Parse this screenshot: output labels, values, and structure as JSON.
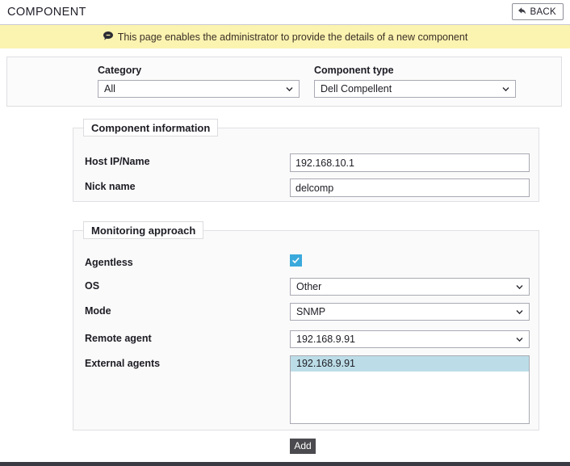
{
  "header": {
    "title": "COMPONENT",
    "back_label": "BACK",
    "back_icon": "back-arrow-icon"
  },
  "info_bar": {
    "icon": "speech-bubble-icon",
    "message": "This page enables the administrator to provide the details of a new component",
    "background_color": "#fbf3b0"
  },
  "selection_panel": {
    "category": {
      "label": "Category",
      "value": "All"
    },
    "component_type": {
      "label": "Component type",
      "value": "Dell Compellent"
    }
  },
  "component_information": {
    "legend": "Component information",
    "host_ip": {
      "label": "Host IP/Name",
      "value": "192.168.10.1"
    },
    "nick_name": {
      "label": "Nick name",
      "value": "delcomp"
    }
  },
  "monitoring_approach": {
    "legend": "Monitoring approach",
    "agentless": {
      "label": "Agentless",
      "checked": "true",
      "color": "#3aa9dc"
    },
    "os": {
      "label": "OS",
      "value": "Other"
    },
    "mode": {
      "label": "Mode",
      "value": "SNMP"
    },
    "remote_agent": {
      "label": "Remote agent",
      "value": "192.168.9.91"
    },
    "external_agents": {
      "label": "External agents",
      "options": [
        {
          "value": "192.168.9.91",
          "selected": true
        }
      ]
    }
  },
  "actions": {
    "add_label": "Add",
    "add_color": "#4b4b4f"
  }
}
